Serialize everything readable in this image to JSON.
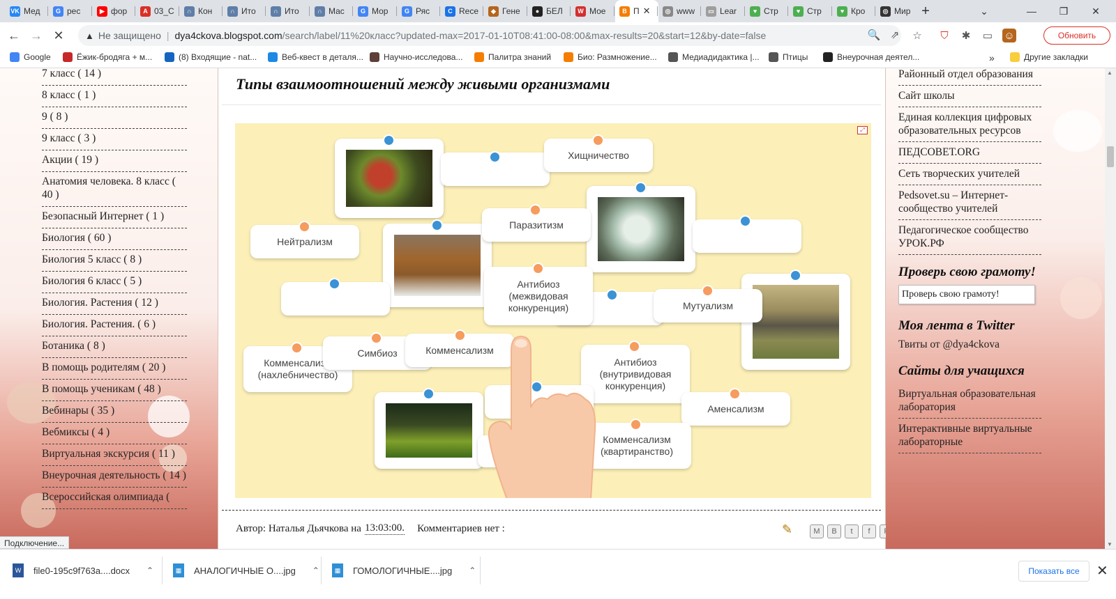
{
  "browser": {
    "tabs": [
      {
        "label": "Мед",
        "color": "#2787f5",
        "glyph": "VK"
      },
      {
        "label": "рес",
        "color": "#4285f4",
        "glyph": "G"
      },
      {
        "label": "фор",
        "color": "#ff0000",
        "glyph": "▶"
      },
      {
        "label": "03_С",
        "color": "#d93025",
        "glyph": "A"
      },
      {
        "label": "Кон",
        "color": "#5f7ea8",
        "glyph": "∩"
      },
      {
        "label": "Ито",
        "color": "#5f7ea8",
        "glyph": "∩"
      },
      {
        "label": "Ито",
        "color": "#5f7ea8",
        "glyph": "∩"
      },
      {
        "label": "Мас",
        "color": "#5f7ea8",
        "glyph": "∩"
      },
      {
        "label": "Мор",
        "color": "#4285f4",
        "glyph": "G"
      },
      {
        "label": "Ряс",
        "color": "#4285f4",
        "glyph": "G"
      },
      {
        "label": "Rece",
        "color": "#1a73e8",
        "glyph": "C"
      },
      {
        "label": "Гене",
        "color": "#b5651d",
        "glyph": "◆"
      },
      {
        "label": "БЕЛ",
        "color": "#222222",
        "glyph": "●"
      },
      {
        "label": "Мое",
        "color": "#d32f2f",
        "glyph": "W"
      },
      {
        "label": "П",
        "color": "#f57d00",
        "glyph": "B",
        "active": true
      },
      {
        "label": "www",
        "color": "#888888",
        "glyph": "◎"
      },
      {
        "label": "Lear",
        "color": "#9e9e9e",
        "glyph": "▭"
      },
      {
        "label": "Стр",
        "color": "#4caf50",
        "glyph": "♥"
      },
      {
        "label": "Стр",
        "color": "#4caf50",
        "glyph": "♥"
      },
      {
        "label": "Кро",
        "color": "#4caf50",
        "glyph": "♥"
      },
      {
        "label": "Мир",
        "color": "#333333",
        "glyph": "◎"
      }
    ],
    "new_tab": "+",
    "tab_close": "✕",
    "window_controls": {
      "dropdown": "⌄",
      "minimize": "—",
      "restore": "❐",
      "close": "✕"
    },
    "nav": {
      "back": "←",
      "forward": "→",
      "stop": "✕"
    },
    "address": {
      "security_icon": "▲",
      "security_label": "Не защищено",
      "host": "dya4ckova.blogspot.com",
      "path": "/search/label/11%20класс?updated-max=2017-01-10T08:41:00-08:00&max-results=20&start=12&by-date=false"
    },
    "toolbar_icons": [
      "🔍",
      "⇗",
      "☆",
      "⛉",
      "✱",
      "▭",
      "☺"
    ],
    "update_label": "Обновить",
    "menu_icon": "⋮",
    "bookmarks": [
      {
        "label": "Google",
        "color": "#4285f4"
      },
      {
        "label": "Ёжик-бродяга + м...",
        "color": "#c62828"
      },
      {
        "label": "(8) Входящие - nat...",
        "color": "#1565c0"
      },
      {
        "label": "Веб-квест в деталя...",
        "color": "#1e88e5"
      },
      {
        "label": "Научно-исследова...",
        "color": "#5d4037"
      },
      {
        "label": "Палитра знаний",
        "color": "#f57d00"
      },
      {
        "label": "Био: Размножение...",
        "color": "#f57d00"
      },
      {
        "label": "Медиадидактика |...",
        "color": "#555555"
      },
      {
        "label": "Птицы",
        "color": "#555555"
      },
      {
        "label": "Внеурочная деятел...",
        "color": "#222222"
      }
    ],
    "bookmarks_more": "»",
    "other_bookmarks": "Другие закладки"
  },
  "sidebar_left": {
    "labels": [
      "7 класс ( 14 )",
      "8 класс ( 1 )",
      "9 ( 8 )",
      "9 класс ( 3 )",
      "Акции ( 19 )",
      "Анатомия человека. 8 класс ( 40 )",
      "Безопасный Интернет ( 1 )",
      "Биология ( 60 )",
      "Биология 5 класс ( 8 )",
      "Биология 6 класс ( 5 )",
      "Биология. Растения ( 12 )",
      "Биология. Растения. ( 6 )",
      "Ботаника ( 8 )",
      "В помощь родителям ( 20 )",
      "В помощь ученикам ( 48 )",
      "Вебинары ( 35 )",
      "Вебмиксы ( 4 )",
      "Виртуальная экскурсия ( 11 )",
      "Внеурочная деятельность ( 14 )",
      "Всероссийская олимпиада ("
    ]
  },
  "post": {
    "title": "Типы взаимоотношений между живыми организмами",
    "cards": {
      "c_hisch": "Хищничество",
      "c_parazit": "Паразитизм",
      "c_neitral": "Нейтрализм",
      "c_antibioz1": "Антибиоз (межвидовая конкуренция)",
      "c_mutual": "Мутуализм",
      "c_simbioz": "Симбиоз",
      "c_kommens": "Комменсализм",
      "c_nahleb": "Комменсализм (нахлебничество)",
      "c_antibioz2": "Антибиоз (внутривидовая конкуренция)",
      "c_amens": "Аменсализм",
      "c_kvartir": "Комменсализм (квартиранство)"
    },
    "author_prefix": "Автор:",
    "author": "Наталья Дьячкова",
    "at": "на",
    "time": "13:03:00.",
    "comments": "Комментариев нет :",
    "share_icons": [
      "M",
      "B",
      "t",
      "f",
      "P"
    ]
  },
  "sidebar_right": {
    "links_top": [
      "Районный отдел образования",
      "Сайт школы",
      "Единая коллекция цифровых образовательных ресурсов",
      "ПЕДСОВЕТ.ORG",
      "Сеть творческих учителей",
      "Pedsovet.su – Интернет-сообщество учителей",
      "Педагогическое сообщество УРОК.РФ"
    ],
    "gramota_heading": "Проверь свою грамоту!",
    "gramota_button": "Проверь свою грамоту!",
    "twitter_heading": "Моя лента в Twitter",
    "tweets_label": "Твиты от @dya4ckova",
    "students_heading": "Сайты для учащихся",
    "links_bottom": [
      "Виртуальная образовательная лаборатория",
      "Интерактивные виртуальные лабораторные"
    ]
  },
  "status_text": "Подключение...",
  "downloads": {
    "items": [
      {
        "name": "file0-195c9f763a....docx",
        "color": "#2b579a",
        "glyph": "W"
      },
      {
        "name": "АНАЛОГИЧНЫЕ О....jpg",
        "color": "#2f8fd6",
        "glyph": "▦"
      },
      {
        "name": "ГОМОЛОГИЧНЫЕ....jpg",
        "color": "#2f8fd6",
        "glyph": "▦"
      }
    ],
    "chevron": "⌃",
    "show_all": "Показать все",
    "close": "✕"
  }
}
